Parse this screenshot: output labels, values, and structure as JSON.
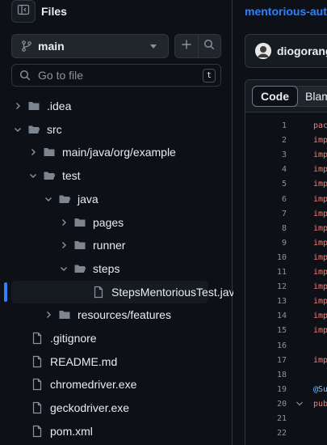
{
  "sidebar": {
    "title": "Files",
    "branch": "main",
    "search": {
      "placeholder": "Go to file",
      "shortcut": "t"
    },
    "tree": [
      {
        "label": ".idea",
        "type": "folder",
        "expanded": false,
        "depth": 0
      },
      {
        "label": "src",
        "type": "folder",
        "expanded": true,
        "depth": 0
      },
      {
        "label": "main/java/org/example",
        "type": "folder",
        "expanded": false,
        "depth": 1
      },
      {
        "label": "test",
        "type": "folder",
        "expanded": true,
        "depth": 1
      },
      {
        "label": "java",
        "type": "folder",
        "expanded": true,
        "depth": 2
      },
      {
        "label": "pages",
        "type": "folder",
        "expanded": false,
        "depth": 3
      },
      {
        "label": "runner",
        "type": "folder",
        "expanded": false,
        "depth": 3
      },
      {
        "label": "steps",
        "type": "folder",
        "expanded": true,
        "depth": 3
      },
      {
        "label": "StepsMentoriousTest.java",
        "type": "file",
        "selected": true,
        "depth": 4
      },
      {
        "label": "resources/features",
        "type": "folder",
        "expanded": false,
        "depth": 2
      },
      {
        "label": ".gitignore",
        "type": "file",
        "depth": 0
      },
      {
        "label": "README.md",
        "type": "file",
        "depth": 0
      },
      {
        "label": "chromedriver.exe",
        "type": "file",
        "depth": 0
      },
      {
        "label": "geckodriver.exe",
        "type": "file",
        "depth": 0
      },
      {
        "label": "pom.xml",
        "type": "file",
        "depth": 0
      }
    ]
  },
  "main": {
    "repo": "mentorious-aut",
    "author": "diogorange",
    "tabs": [
      {
        "label": "Code",
        "active": true
      },
      {
        "label": "Blam",
        "active": false
      }
    ],
    "lines": [
      {
        "n": "1",
        "text": "pac",
        "color": "#ff7b72"
      },
      {
        "n": "2",
        "text": "imp",
        "color": "#ff7b72"
      },
      {
        "n": "3",
        "text": "imp",
        "color": "#ff7b72"
      },
      {
        "n": "4",
        "text": "imp",
        "color": "#ff7b72"
      },
      {
        "n": "5",
        "text": "imp",
        "color": "#ff7b72"
      },
      {
        "n": "6",
        "text": "imp",
        "color": "#ff7b72"
      },
      {
        "n": "7",
        "text": "imp",
        "color": "#ff7b72"
      },
      {
        "n": "8",
        "text": "imp",
        "color": "#ff7b72"
      },
      {
        "n": "9",
        "text": "imp",
        "color": "#ff7b72"
      },
      {
        "n": "10",
        "text": "imp",
        "color": "#ff7b72"
      },
      {
        "n": "11",
        "text": "imp",
        "color": "#ff7b72"
      },
      {
        "n": "12",
        "text": "imp",
        "color": "#ff7b72"
      },
      {
        "n": "13",
        "text": "imp",
        "color": "#ff7b72"
      },
      {
        "n": "14",
        "text": "imp",
        "color": "#ff7b72"
      },
      {
        "n": "15",
        "text": "imp",
        "color": "#ff7b72"
      },
      {
        "n": "16",
        "text": "",
        "color": "#e6edf3"
      },
      {
        "n": "17",
        "text": "imp",
        "color": "#ff7b72"
      },
      {
        "n": "18",
        "text": "",
        "color": "#e6edf3"
      },
      {
        "n": "19",
        "text": "@Su",
        "color": "#79c0ff"
      },
      {
        "n": "20",
        "text": "pub",
        "color": "#ff7b72",
        "fold": true
      },
      {
        "n": "21",
        "text": "",
        "color": "#e6edf3"
      },
      {
        "n": "22",
        "text": "",
        "color": "#e6edf3"
      }
    ]
  },
  "colors": {
    "background": "#0d1117",
    "border": "#30363d",
    "accent": "#2f81f7",
    "folder": "#7d8590",
    "text": "#e6edf3",
    "muted": "#8b949e"
  }
}
